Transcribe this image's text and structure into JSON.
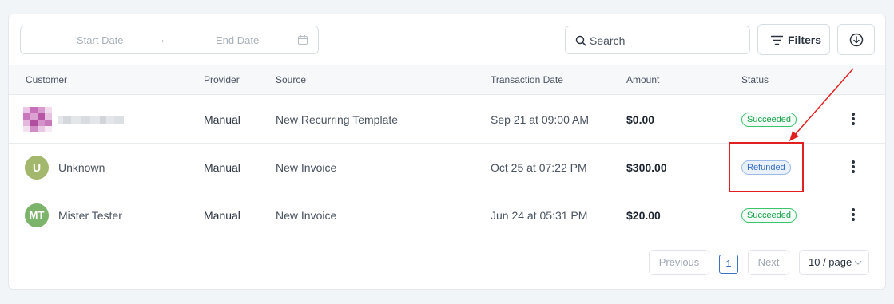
{
  "toolbar": {
    "date_start_placeholder": "Start Date",
    "date_arrow": "→",
    "date_end_placeholder": "End Date",
    "search_placeholder": "Search",
    "filters_label": "Filters"
  },
  "table": {
    "columns": [
      "Customer",
      "Provider",
      "Source",
      "Transaction Date",
      "Amount",
      "Status"
    ],
    "rows": [
      {
        "avatar": "",
        "customer": "",
        "provider": "Manual",
        "source": "New Recurring Template",
        "date": "Sep 21 at 09:00 AM",
        "amount": "$0.00",
        "status": "Succeeded"
      },
      {
        "avatar": "U",
        "customer": "Unknown",
        "provider": "Manual",
        "source": "New Invoice",
        "date": "Oct 25 at 07:22 PM",
        "amount": "$300.00",
        "status": "Refunded"
      },
      {
        "avatar": "MT",
        "customer": "Mister Tester",
        "provider": "Manual",
        "source": "New Invoice",
        "date": "Jun 24 at 05:31 PM",
        "amount": "$20.00",
        "status": "Succeeded"
      }
    ]
  },
  "pagination": {
    "previous_label": "Previous",
    "current_page": "1",
    "next_label": "Next",
    "page_size": "10 / page"
  },
  "colors": {
    "avatar_u": "#a3b86c",
    "avatar_mt": "#7cb46b",
    "succeeded": "#17a34a",
    "refunded": "#3b6fc4",
    "annotation": "#e02020"
  }
}
